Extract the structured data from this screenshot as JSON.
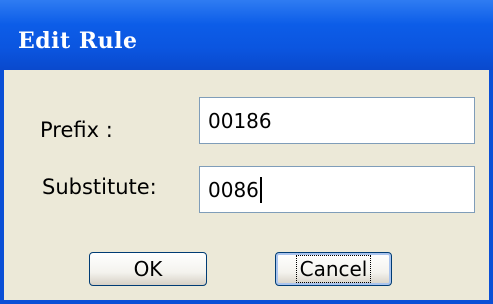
{
  "dialog": {
    "title": "Edit Rule"
  },
  "form": {
    "prefix_label": "Prefix :",
    "prefix_value": "00186",
    "substitute_label": "Substitute:",
    "substitute_value": "0086"
  },
  "buttons": {
    "ok_label": "OK",
    "cancel_label": "Cancel"
  },
  "colors": {
    "titlebar": "#0a4fd6",
    "dialog_background": "#ece9d8"
  }
}
